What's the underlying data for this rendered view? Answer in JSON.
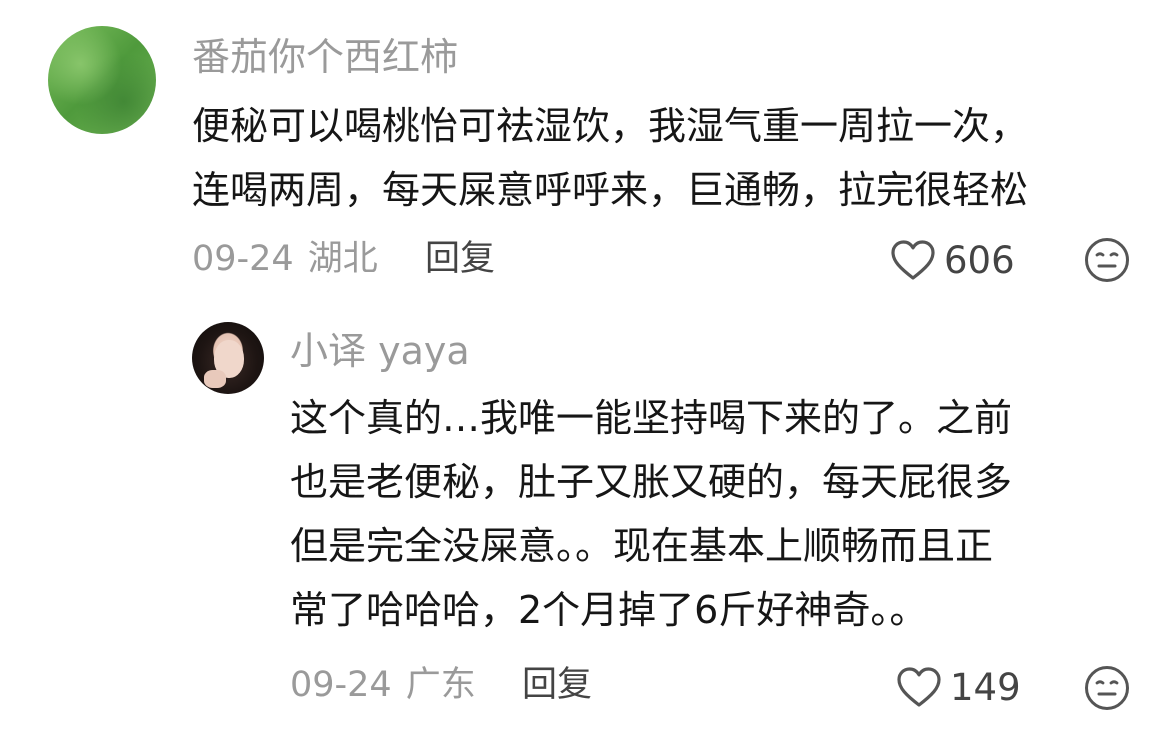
{
  "comments": [
    {
      "username": "番茄你个西红柿",
      "lines": [
        "便秘可以喝桃怡可祛湿饮，我湿气重一周拉一次，",
        "连喝两周，每天屎意呼呼来，巨通畅，拉完很轻松"
      ],
      "date": "09-24",
      "location": "湖北",
      "reply_label": "回复",
      "likes": "606",
      "like_icon": "heart-outline-icon",
      "emoji_icon": "meh-face-icon"
    },
    {
      "username": "小译 yaya",
      "lines": [
        "这个真的…我唯一能坚持喝下来的了。之前",
        "也是老便秘，肚子又胀又硬的，每天屁很多",
        "但是完全没屎意。。现在基本上顺畅而且正",
        "常了哈哈哈，2个月掉了6斤好神奇。。"
      ],
      "date": "09-24",
      "location": "广东",
      "reply_label": "回复",
      "likes": "149",
      "like_icon": "heart-outline-icon",
      "emoji_icon": "meh-face-icon"
    }
  ],
  "colors": {
    "muted_text": "#9a9a9a",
    "body_text": "#161616",
    "icon_stroke": "#555555"
  }
}
